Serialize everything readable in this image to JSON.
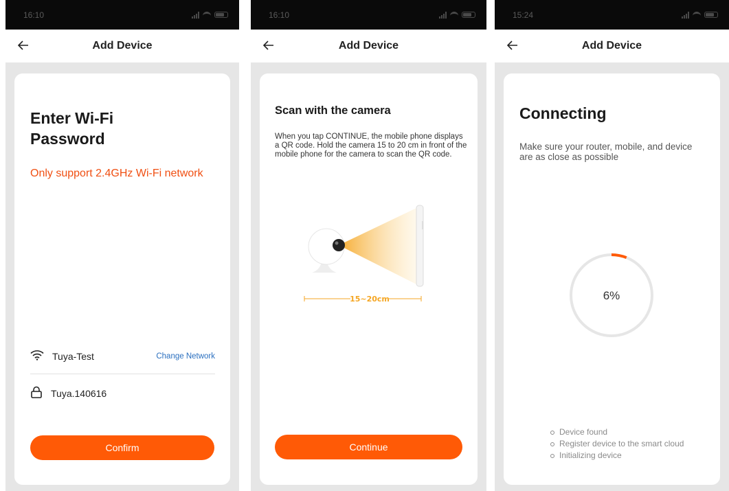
{
  "screens": [
    {
      "status_time": "16:10",
      "title": "Add Device",
      "heading": "Enter Wi-Fi Password",
      "warning": "Only support 2.4GHz Wi-Fi network",
      "network_name": "Tuya-Test",
      "change_network_label": "Change Network",
      "password_value": "Tuya.140616",
      "button_label": "Confirm"
    },
    {
      "status_time": "16:10",
      "title": "Add Device",
      "heading": "Scan with the camera",
      "description": "When you tap CONTINUE, the mobile phone displays a QR code. Hold the camera 15 to 20 cm in front of the mobile phone for the camera to scan the QR code.",
      "distance_label": "15~20cm",
      "button_label": "Continue"
    },
    {
      "status_time": "15:24",
      "title": "Add Device",
      "heading": "Connecting",
      "description": "Make sure your router, mobile, and device are as close as possible",
      "progress_text": "6%",
      "progress_value": 0.06,
      "steps": [
        "Device found",
        "Register device to the smart cloud",
        "Initializing device"
      ]
    }
  ],
  "colors": {
    "accent": "#ff5a06",
    "warning": "#f04f12",
    "link": "#2a6fbf",
    "progress_track": "#e6e6e6"
  },
  "icons": {
    "back": "arrow-left-icon",
    "wifi": "wifi-icon",
    "lock": "lock-icon"
  }
}
